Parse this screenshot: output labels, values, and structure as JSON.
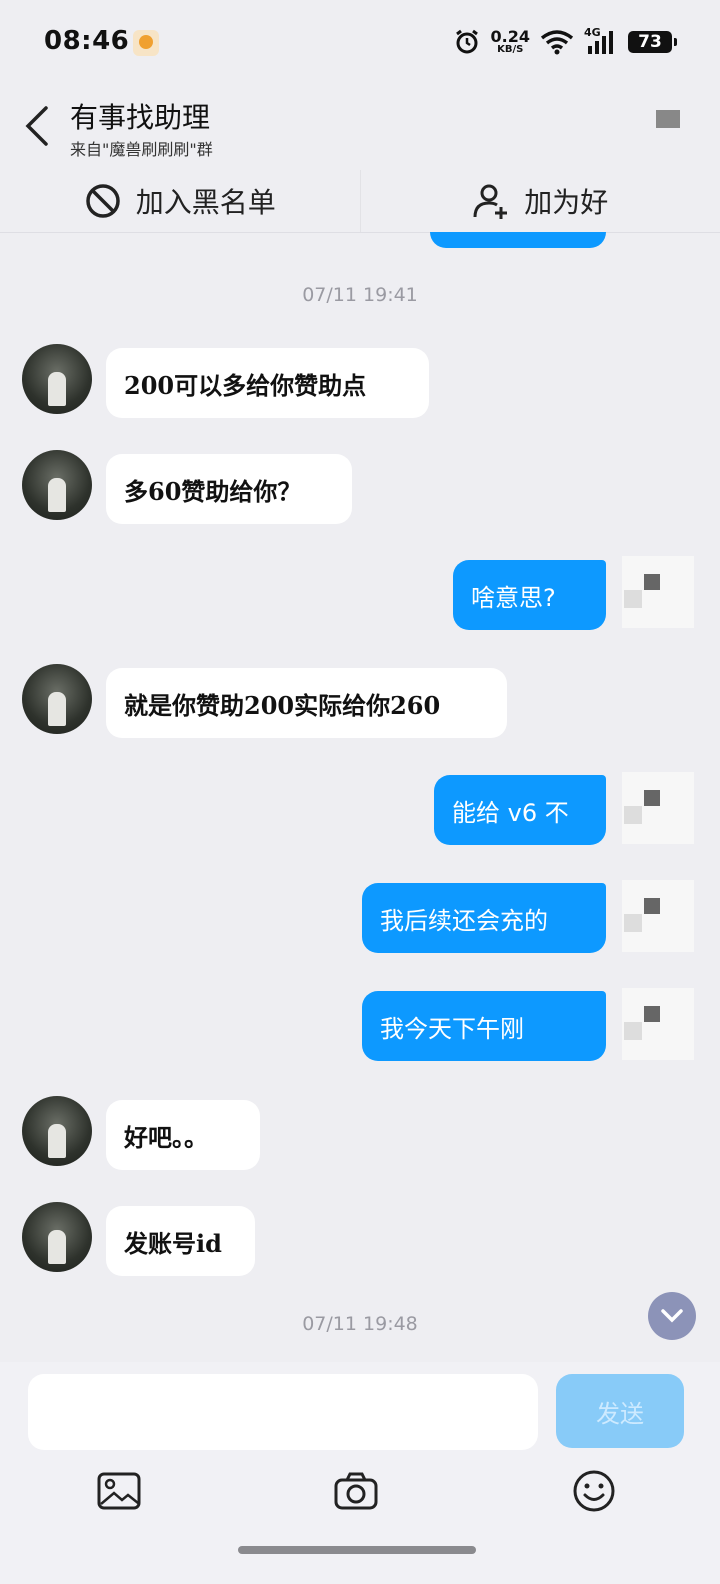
{
  "status_bar": {
    "time": "08:46",
    "net_speed": "0.24",
    "net_unit": "KB/S",
    "network": "4G",
    "battery": "73"
  },
  "header": {
    "title": "有事找助理",
    "subtitle": "来自\"魔兽刷刷刷\"群"
  },
  "actions": {
    "blacklist_label": "加入黑名单",
    "add_friend_label": "加为好"
  },
  "timestamps": [
    "07/11 19:41",
    "07/11 19:48"
  ],
  "messages": [
    {
      "side": "in",
      "text": "200可以多给你赞助点"
    },
    {
      "side": "in",
      "text": "多60赞助给你？"
    },
    {
      "side": "out",
      "text": "啥意思?"
    },
    {
      "side": "in",
      "text": "就是你赞助200实际给你260"
    },
    {
      "side": "out",
      "text": "能给 v6 不"
    },
    {
      "side": "out",
      "text": "我后续还会充的"
    },
    {
      "side": "out",
      "text": "我今天下午刚"
    },
    {
      "side": "in",
      "text": "好吧。。"
    },
    {
      "side": "in",
      "text": "发账号id"
    }
  ],
  "composer": {
    "input_value": "",
    "send_label": "发送"
  },
  "icons": [
    "back-icon",
    "more-icon",
    "block-icon",
    "add-user-icon",
    "scroll-down-icon",
    "image-icon",
    "camera-icon",
    "emoji-icon"
  ]
}
